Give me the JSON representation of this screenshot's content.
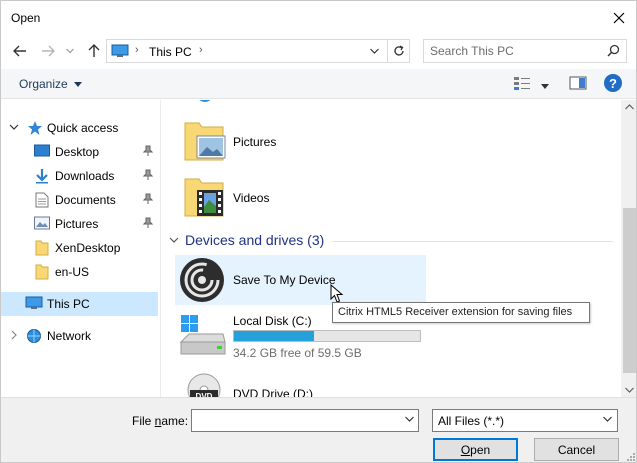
{
  "window": {
    "title": "Open"
  },
  "address": {
    "location": "This PC"
  },
  "search": {
    "placeholder": "Search This PC"
  },
  "toolbar": {
    "organize_label": "Organize"
  },
  "nav": {
    "quick_access": "Quick access",
    "items": [
      {
        "label": "Desktop",
        "pinned": true
      },
      {
        "label": "Downloads",
        "pinned": true
      },
      {
        "label": "Documents",
        "pinned": true
      },
      {
        "label": "Pictures",
        "pinned": true
      },
      {
        "label": "XenDesktop",
        "pinned": false
      },
      {
        "label": "en-US",
        "pinned": false
      }
    ],
    "this_pc": "This PC",
    "network": "Network"
  },
  "content": {
    "folders": [
      {
        "label": "Pictures"
      },
      {
        "label": "Videos"
      }
    ],
    "group_header": "Devices and drives (3)",
    "devices": [
      {
        "label": "Save To My Device"
      },
      {
        "label": "Local Disk (C:)",
        "free": "34.2 GB free of 59.5 GB",
        "used_fraction": 0.43
      },
      {
        "label": "DVD Drive (D:)"
      }
    ],
    "tooltip": "Citrix HTML5 Receiver extension for saving files"
  },
  "footer": {
    "file_name_label_pre": "File ",
    "file_name_label_u": "n",
    "file_name_label_post": "ame:",
    "file_name_value": "",
    "file_type": "All Files (*.*)",
    "open_u": "O",
    "open_rest": "pen",
    "cancel_label": "Cancel"
  },
  "colors": {
    "accent": "#0078d7",
    "selection": "#cce8ff",
    "progress": "#26a0da",
    "group_header": "#1e3287"
  }
}
